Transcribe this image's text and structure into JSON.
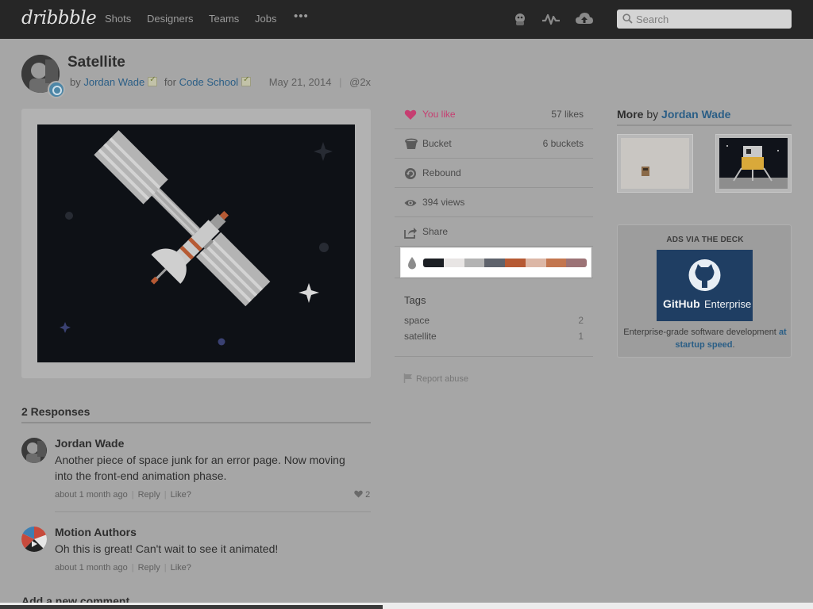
{
  "nav": {
    "logo": "dribbble",
    "links": [
      "Shots",
      "Designers",
      "Teams",
      "Jobs"
    ],
    "more": "•••",
    "search_placeholder": "Search"
  },
  "shot": {
    "title": "Satellite",
    "by_prefix": "by",
    "author": "Jordan Wade",
    "for_prefix": "for",
    "team": "Code School",
    "date": "May 21, 2014",
    "separator": "|",
    "resolution": "@2x"
  },
  "stats": {
    "like_label": "You like",
    "likes": "57 likes",
    "bucket_label": "Bucket",
    "buckets": "6 buckets",
    "rebound_label": "Rebound",
    "views": "394 views",
    "share_label": "Share"
  },
  "palette": [
    "#1c1f24",
    "#e8e5e4",
    "#b3b3b3",
    "#5f636c",
    "#b65a34",
    "#dcb7a6",
    "#c3764f",
    "#9c7376"
  ],
  "tags": {
    "title": "Tags",
    "items": [
      {
        "name": "space",
        "count": "2"
      },
      {
        "name": "satellite",
        "count": "1"
      }
    ]
  },
  "report": "Report abuse",
  "responses": {
    "title": "2 Responses",
    "items": [
      {
        "author": "Jordan Wade",
        "body": "Another piece of space junk for an error page. Now moving into the front-end animation phase.",
        "time": "about 1 month ago",
        "reply": "Reply",
        "like": "Like?",
        "likes": "2"
      },
      {
        "author": "Motion Authors",
        "body": "Oh this is great! Can't wait to see it animated!",
        "time": "about 1 month ago",
        "reply": "Reply",
        "like": "Like?"
      }
    ],
    "add_comment": "Add a new comment"
  },
  "more": {
    "prefix": "More",
    "by": "by",
    "author": "Jordan Wade"
  },
  "ad": {
    "heading": "ADS VIA THE DECK",
    "brand": "GitHub",
    "product": "Enterprise",
    "text": "Enterprise-grade software development",
    "link": "at startup speed",
    "suffix": "."
  },
  "colors": {
    "nav_bg": "#262626",
    "link": "#2a5e86",
    "like_pink": "#c63e71",
    "overlay": "#a6a6a6"
  }
}
